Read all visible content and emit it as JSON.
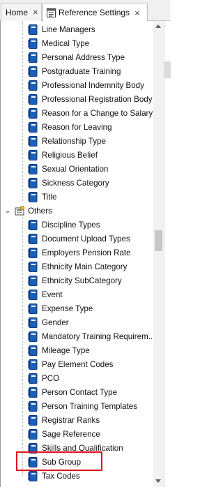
{
  "tabs": [
    {
      "label": "Home",
      "close": "×"
    },
    {
      "label": "Reference Settings",
      "close": "×"
    }
  ],
  "tree": {
    "items_before": [
      "Line Managers",
      "Medical Type",
      "Personal Address Type",
      "Postgraduate Training",
      "Professional Indemnity Body",
      "Professional Registration Body",
      "Reason for a Change to Salary",
      "Reason for Leaving",
      "Relationship Type",
      "Religious Belief",
      "Sexual Orientation",
      "Sickness Category",
      "Title"
    ],
    "group": {
      "label": "Others",
      "icon": "folder-icon",
      "chevron": "⌄"
    },
    "others": [
      "Discipline Types",
      "Document Upload Types",
      "Employers Pension Rate",
      "Ethnicity Main Category",
      "Ethnicity SubCategory",
      "Event",
      "Expense Type",
      "Gender",
      "Mandatory Training Requirem...",
      "Mileage Type",
      "Pay Element Codes",
      "PCO",
      "Person Contact Type",
      "Person Training Templates",
      "Registrar Ranks",
      "Sage Reference",
      "Skills and Qualification",
      "Sub Group",
      "Tax Codes"
    ]
  },
  "colors": {
    "book_icon": "#1b5fb8",
    "highlight_border": "#e0101e"
  }
}
